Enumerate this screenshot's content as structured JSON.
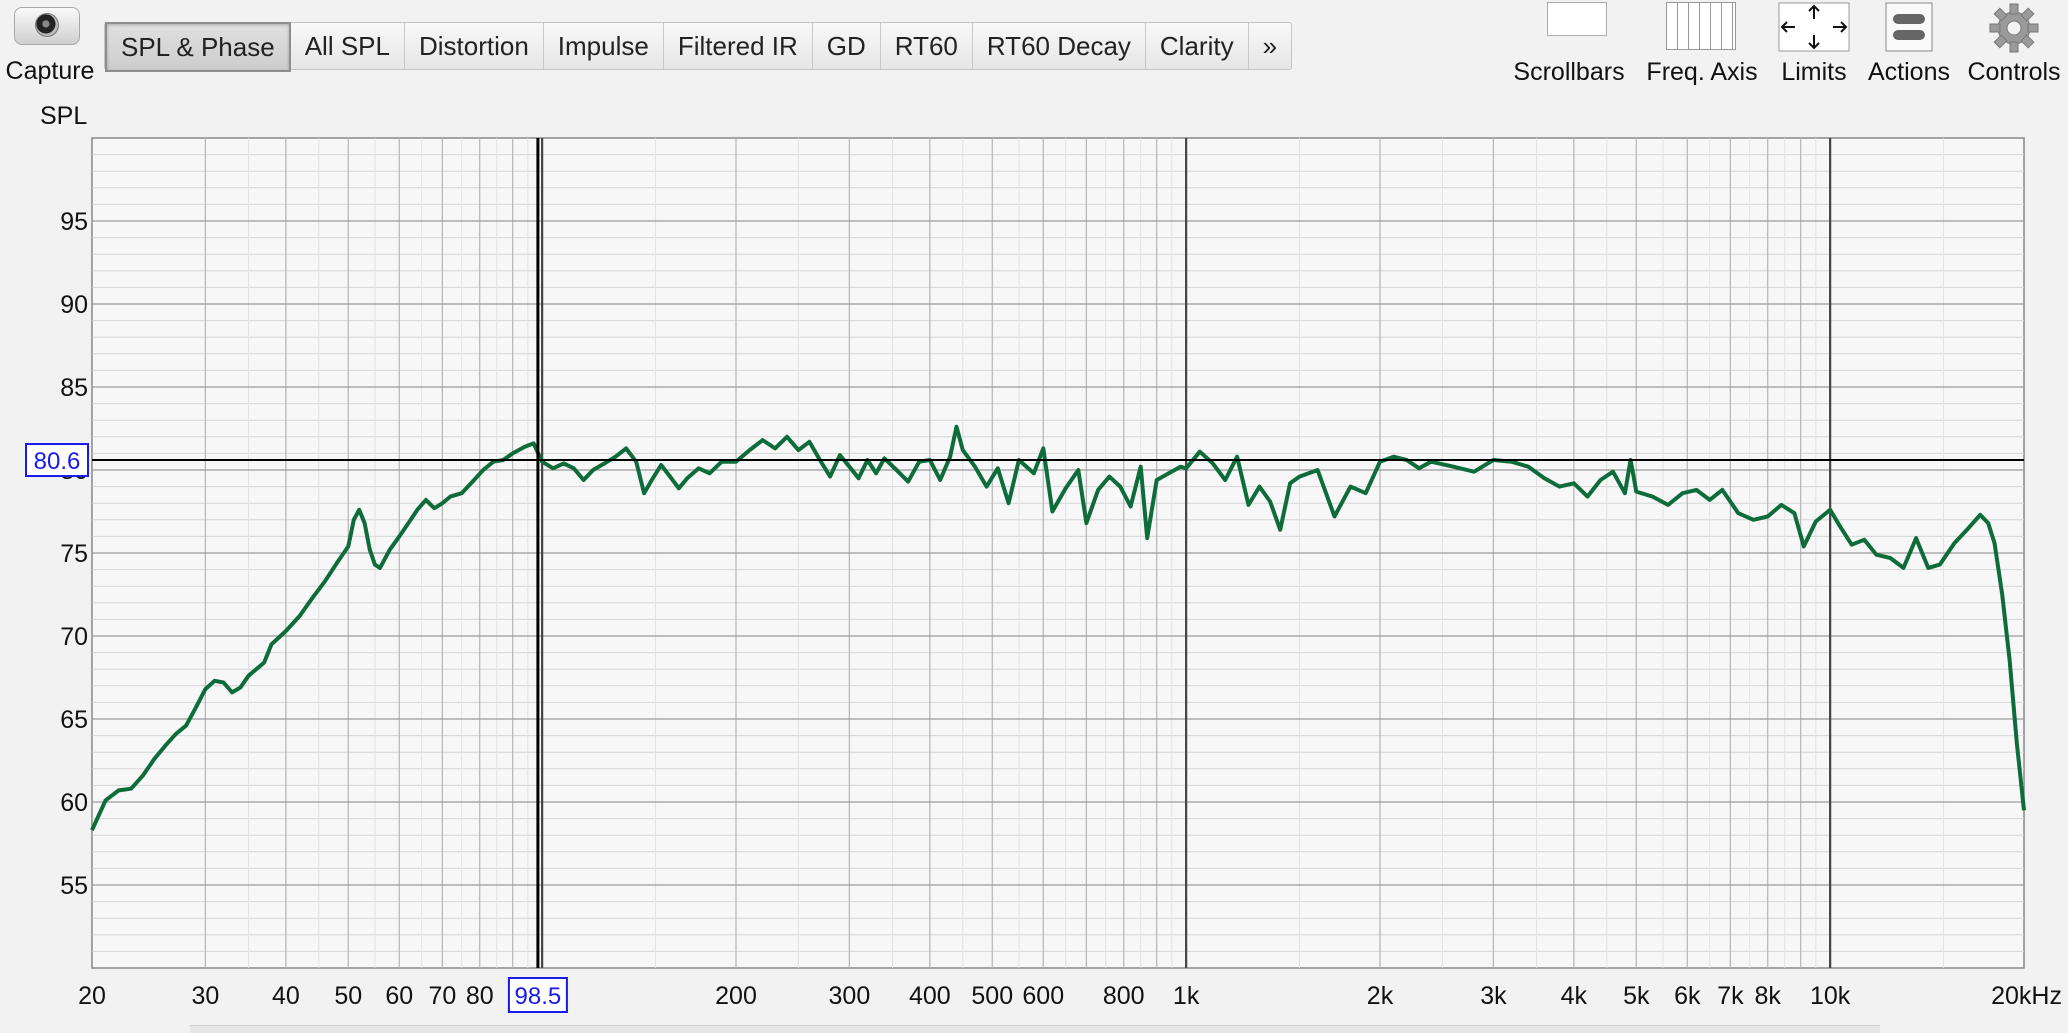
{
  "toolbar": {
    "capture_label": "Capture",
    "tabs": [
      {
        "label": "SPL & Phase",
        "active": true
      },
      {
        "label": "All SPL"
      },
      {
        "label": "Distortion"
      },
      {
        "label": "Impulse"
      },
      {
        "label": "Filtered IR"
      },
      {
        "label": "GD"
      },
      {
        "label": "RT60"
      },
      {
        "label": "RT60 Decay"
      },
      {
        "label": "Clarity"
      },
      {
        "label": "»"
      }
    ],
    "right_buttons": {
      "scrollbars": "Scrollbars",
      "freq_axis": "Freq. Axis",
      "limits": "Limits",
      "actions": "Actions",
      "controls": "Controls"
    }
  },
  "chart": {
    "y_title": "SPL",
    "cursor_x_readout": "98.5",
    "cursor_y_readout": "80.6",
    "line_color": "#0e6b3a",
    "readout_color": "#1a1ae6"
  },
  "chart_data": {
    "type": "line",
    "title": "",
    "xlabel": "",
    "ylabel": "SPL",
    "x_scale": "log",
    "xlim": [
      20,
      20000
    ],
    "ylim": [
      50,
      100
    ],
    "grid": true,
    "x_tick_labels": [
      "20",
      "30",
      "40",
      "50",
      "60",
      "70",
      "80",
      "98.5",
      "200",
      "300",
      "400",
      "500",
      "600",
      "800",
      "1k",
      "2k",
      "3k",
      "4k",
      "5k",
      "6k",
      "7k",
      "8k",
      "10k",
      "20kHz"
    ],
    "y_tick_labels": [
      "55",
      "60",
      "65",
      "70",
      "75",
      "80",
      "85",
      "90",
      "95"
    ],
    "cursor": {
      "x": 98.5,
      "y": 80.6
    },
    "series": [
      {
        "points": [
          [
            20,
            58.3
          ],
          [
            21,
            60.1
          ],
          [
            22,
            60.7
          ],
          [
            23,
            60.8
          ],
          [
            24,
            61.6
          ],
          [
            25,
            62.6
          ],
          [
            26,
            63.4
          ],
          [
            27,
            64.1
          ],
          [
            28,
            64.6
          ],
          [
            29,
            65.7
          ],
          [
            30,
            66.8
          ],
          [
            31,
            67.3
          ],
          [
            32,
            67.2
          ],
          [
            33,
            66.6
          ],
          [
            34,
            66.9
          ],
          [
            35,
            67.6
          ],
          [
            37,
            68.4
          ],
          [
            38,
            69.5
          ],
          [
            40,
            70.3
          ],
          [
            42,
            71.2
          ],
          [
            44,
            72.3
          ],
          [
            46,
            73.3
          ],
          [
            48,
            74.4
          ],
          [
            50,
            75.4
          ],
          [
            51,
            77.0
          ],
          [
            52,
            77.6
          ],
          [
            53,
            76.8
          ],
          [
            54,
            75.2
          ],
          [
            55,
            74.3
          ],
          [
            56,
            74.1
          ],
          [
            58,
            75.2
          ],
          [
            60,
            76.0
          ],
          [
            62,
            76.8
          ],
          [
            64,
            77.6
          ],
          [
            66,
            78.2
          ],
          [
            68,
            77.7
          ],
          [
            70,
            78.0
          ],
          [
            72,
            78.4
          ],
          [
            75,
            78.6
          ],
          [
            78,
            79.3
          ],
          [
            81,
            80.0
          ],
          [
            84,
            80.5
          ],
          [
            87,
            80.6
          ],
          [
            90,
            81.0
          ],
          [
            94,
            81.4
          ],
          [
            97,
            81.6
          ],
          [
            100,
            80.5
          ],
          [
            104,
            80.1
          ],
          [
            108,
            80.4
          ],
          [
            112,
            80.1
          ],
          [
            116,
            79.4
          ],
          [
            120,
            80.0
          ],
          [
            125,
            80.4
          ],
          [
            130,
            80.8
          ],
          [
            135,
            81.3
          ],
          [
            140,
            80.5
          ],
          [
            144,
            78.6
          ],
          [
            148,
            79.4
          ],
          [
            153,
            80.3
          ],
          [
            158,
            79.6
          ],
          [
            163,
            78.9
          ],
          [
            168,
            79.5
          ],
          [
            175,
            80.1
          ],
          [
            182,
            79.8
          ],
          [
            190,
            80.5
          ],
          [
            200,
            80.5
          ],
          [
            210,
            81.2
          ],
          [
            220,
            81.8
          ],
          [
            230,
            81.3
          ],
          [
            240,
            82.0
          ],
          [
            250,
            81.2
          ],
          [
            260,
            81.7
          ],
          [
            270,
            80.6
          ],
          [
            280,
            79.6
          ],
          [
            290,
            80.9
          ],
          [
            300,
            80.2
          ],
          [
            310,
            79.5
          ],
          [
            320,
            80.6
          ],
          [
            330,
            79.8
          ],
          [
            340,
            80.7
          ],
          [
            355,
            80.0
          ],
          [
            370,
            79.3
          ],
          [
            385,
            80.5
          ],
          [
            400,
            80.6
          ],
          [
            415,
            79.4
          ],
          [
            430,
            80.8
          ],
          [
            440,
            82.6
          ],
          [
            450,
            81.2
          ],
          [
            470,
            80.2
          ],
          [
            490,
            79.0
          ],
          [
            510,
            80.1
          ],
          [
            530,
            78.0
          ],
          [
            550,
            80.6
          ],
          [
            580,
            79.8
          ],
          [
            600,
            81.3
          ],
          [
            620,
            77.5
          ],
          [
            650,
            78.9
          ],
          [
            680,
            80.0
          ],
          [
            700,
            76.8
          ],
          [
            730,
            78.8
          ],
          [
            760,
            79.6
          ],
          [
            790,
            79.0
          ],
          [
            820,
            77.8
          ],
          [
            850,
            80.2
          ],
          [
            870,
            75.9
          ],
          [
            900,
            79.4
          ],
          [
            940,
            79.8
          ],
          [
            980,
            80.2
          ],
          [
            1000,
            80.1
          ],
          [
            1050,
            81.1
          ],
          [
            1100,
            80.4
          ],
          [
            1150,
            79.4
          ],
          [
            1200,
            80.8
          ],
          [
            1250,
            77.9
          ],
          [
            1300,
            79.0
          ],
          [
            1350,
            78.1
          ],
          [
            1400,
            76.4
          ],
          [
            1450,
            79.2
          ],
          [
            1500,
            79.6
          ],
          [
            1600,
            80.0
          ],
          [
            1700,
            77.2
          ],
          [
            1800,
            79.0
          ],
          [
            1900,
            78.6
          ],
          [
            2000,
            80.5
          ],
          [
            2100,
            80.8
          ],
          [
            2200,
            80.6
          ],
          [
            2300,
            80.1
          ],
          [
            2400,
            80.5
          ],
          [
            2600,
            80.2
          ],
          [
            2800,
            79.9
          ],
          [
            3000,
            80.6
          ],
          [
            3200,
            80.5
          ],
          [
            3400,
            80.2
          ],
          [
            3600,
            79.5
          ],
          [
            3800,
            79.0
          ],
          [
            4000,
            79.2
          ],
          [
            4200,
            78.4
          ],
          [
            4400,
            79.4
          ],
          [
            4600,
            79.9
          ],
          [
            4800,
            78.6
          ],
          [
            4900,
            80.6
          ],
          [
            5000,
            78.7
          ],
          [
            5300,
            78.4
          ],
          [
            5600,
            77.9
          ],
          [
            5900,
            78.6
          ],
          [
            6200,
            78.8
          ],
          [
            6500,
            78.2
          ],
          [
            6800,
            78.8
          ],
          [
            7200,
            77.4
          ],
          [
            7600,
            77.0
          ],
          [
            8000,
            77.2
          ],
          [
            8400,
            77.9
          ],
          [
            8800,
            77.4
          ],
          [
            9100,
            75.4
          ],
          [
            9500,
            76.9
          ],
          [
            10000,
            77.6
          ],
          [
            10400,
            76.5
          ],
          [
            10800,
            75.5
          ],
          [
            11300,
            75.8
          ],
          [
            11800,
            74.9
          ],
          [
            12400,
            74.7
          ],
          [
            13000,
            74.1
          ],
          [
            13600,
            75.9
          ],
          [
            14200,
            74.1
          ],
          [
            14800,
            74.3
          ],
          [
            15600,
            75.6
          ],
          [
            16400,
            76.5
          ],
          [
            17100,
            77.3
          ],
          [
            17600,
            76.8
          ],
          [
            18000,
            75.6
          ],
          [
            18500,
            72.5
          ],
          [
            19000,
            68.5
          ],
          [
            19500,
            63.5
          ],
          [
            20000,
            59.5
          ]
        ]
      }
    ]
  }
}
